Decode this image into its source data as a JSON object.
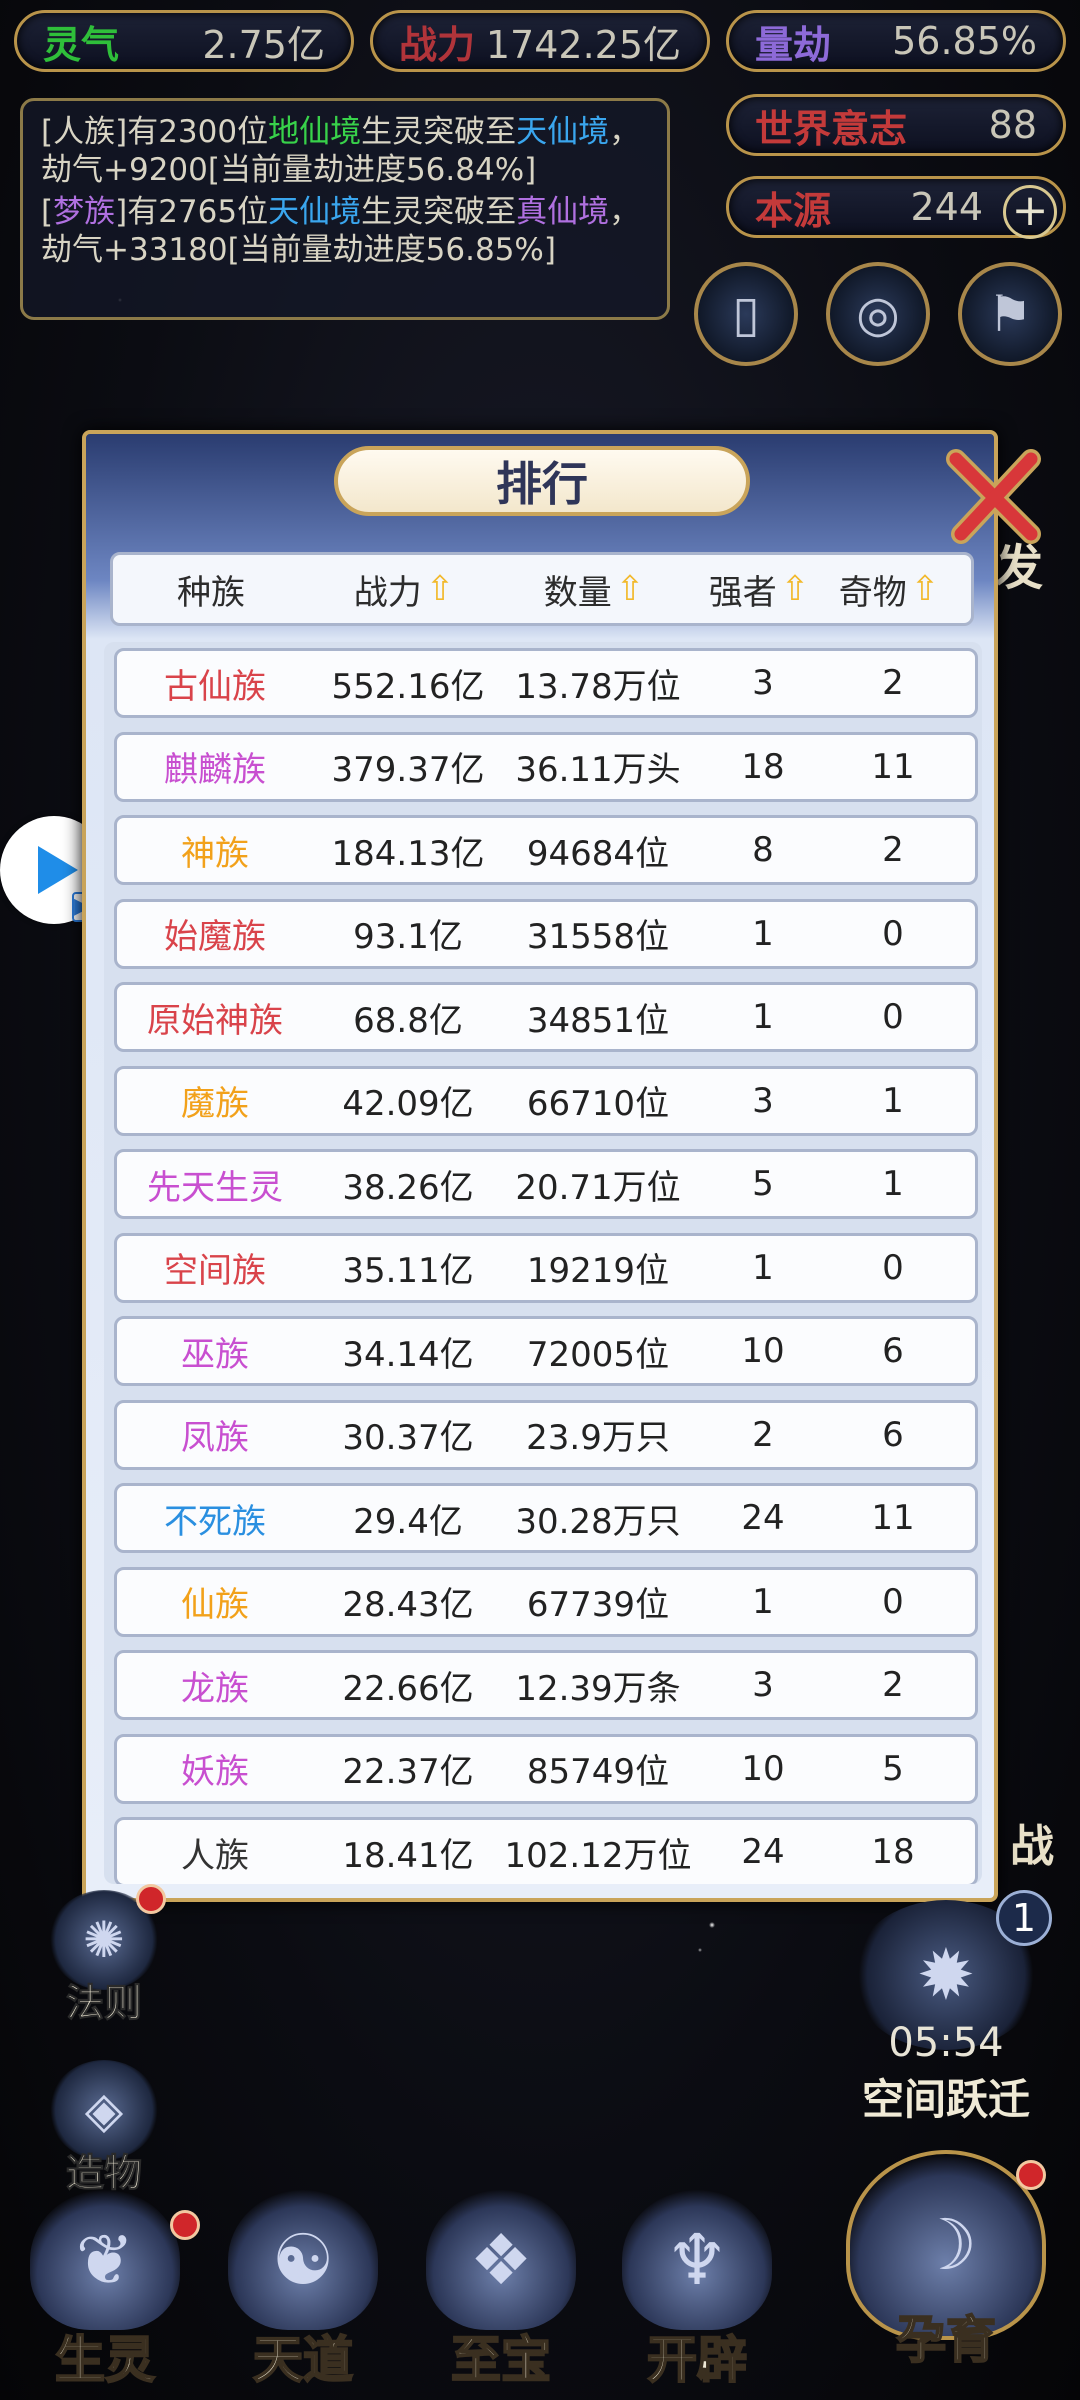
{
  "stats": {
    "lingqi": {
      "label": "灵气",
      "value": "2.75亿",
      "color": "#2fbf3a"
    },
    "zhanli": {
      "label": "战力",
      "value": "1742.25亿",
      "color": "#b0343a"
    },
    "liangjie": {
      "label": "量劫",
      "value": "56.85%",
      "color": "#8d6ad8"
    },
    "world_will": {
      "label": "世界意志",
      "value": "88",
      "color": "#c43a3a"
    },
    "benyuan": {
      "label": "本源",
      "value": "244",
      "color": "#c43a3a"
    }
  },
  "messages": [
    {
      "a": "[人族]有2300位",
      "b": "地仙境",
      "c": "生灵突破至",
      "d": "天仙境",
      "e": "，劫气+9200[当前量劫进度56.84%]"
    },
    {
      "a": "[",
      "a2": "梦族",
      "a3": "]有2765位",
      "b": "天仙境",
      "c": "生灵突破至",
      "d": "真仙境",
      "e": "，劫气+33180[当前量劫进度56.85%]"
    }
  ],
  "side_labels": {
    "fa": "发",
    "zhan": "战"
  },
  "modal": {
    "title": "排行",
    "headers": {
      "race": "种族",
      "power": "战力",
      "count": "数量",
      "strong": "强者",
      "treasure": "奇物"
    },
    "rows": [
      {
        "race": "古仙族",
        "color": "#d9434a",
        "power": "552.16亿",
        "count": "13.78万位",
        "strong": "3",
        "treasure": "2"
      },
      {
        "race": "麒麟族",
        "color": "#c84fd0",
        "power": "379.37亿",
        "count": "36.11万头",
        "strong": "18",
        "treasure": "11"
      },
      {
        "race": "神族",
        "color": "#f2a11a",
        "power": "184.13亿",
        "count": "94684位",
        "strong": "8",
        "treasure": "2"
      },
      {
        "race": "始魔族",
        "color": "#d9434a",
        "power": "93.1亿",
        "count": "31558位",
        "strong": "1",
        "treasure": "0"
      },
      {
        "race": "原始神族",
        "color": "#d9434a",
        "power": "68.8亿",
        "count": "34851位",
        "strong": "1",
        "treasure": "0"
      },
      {
        "race": "魔族",
        "color": "#f2a11a",
        "power": "42.09亿",
        "count": "66710位",
        "strong": "3",
        "treasure": "1"
      },
      {
        "race": "先天生灵",
        "color": "#c84fd0",
        "power": "38.26亿",
        "count": "20.71万位",
        "strong": "5",
        "treasure": "1"
      },
      {
        "race": "空间族",
        "color": "#d9434a",
        "power": "35.11亿",
        "count": "19219位",
        "strong": "1",
        "treasure": "0"
      },
      {
        "race": "巫族",
        "color": "#c84fd0",
        "power": "34.14亿",
        "count": "72005位",
        "strong": "10",
        "treasure": "6"
      },
      {
        "race": "凤族",
        "color": "#c84fd0",
        "power": "30.37亿",
        "count": "23.9万只",
        "strong": "2",
        "treasure": "6"
      },
      {
        "race": "不死族",
        "color": "#2a8fe0",
        "power": "29.4亿",
        "count": "30.28万只",
        "strong": "24",
        "treasure": "11"
      },
      {
        "race": "仙族",
        "color": "#f2a11a",
        "power": "28.43亿",
        "count": "67739位",
        "strong": "1",
        "treasure": "0"
      },
      {
        "race": "龙族",
        "color": "#c84fd0",
        "power": "22.66亿",
        "count": "12.39万条",
        "strong": "3",
        "treasure": "2"
      },
      {
        "race": "妖族",
        "color": "#c84fd0",
        "power": "22.37亿",
        "count": "85749位",
        "strong": "10",
        "treasure": "5"
      },
      {
        "race": "人族",
        "color": "#333333",
        "power": "18.41亿",
        "count": "102.12万位",
        "strong": "24",
        "treasure": "18"
      }
    ]
  },
  "left_menu": [
    {
      "label": "法则"
    },
    {
      "label": "造物"
    }
  ],
  "space_jump": {
    "timer": "05:54",
    "label": "空间跃迁",
    "badge": "1"
  },
  "bottom_menu": [
    {
      "label": "生灵"
    },
    {
      "label": "天道"
    },
    {
      "label": "至宝"
    },
    {
      "label": "开辟"
    },
    {
      "label": "孕育"
    }
  ]
}
